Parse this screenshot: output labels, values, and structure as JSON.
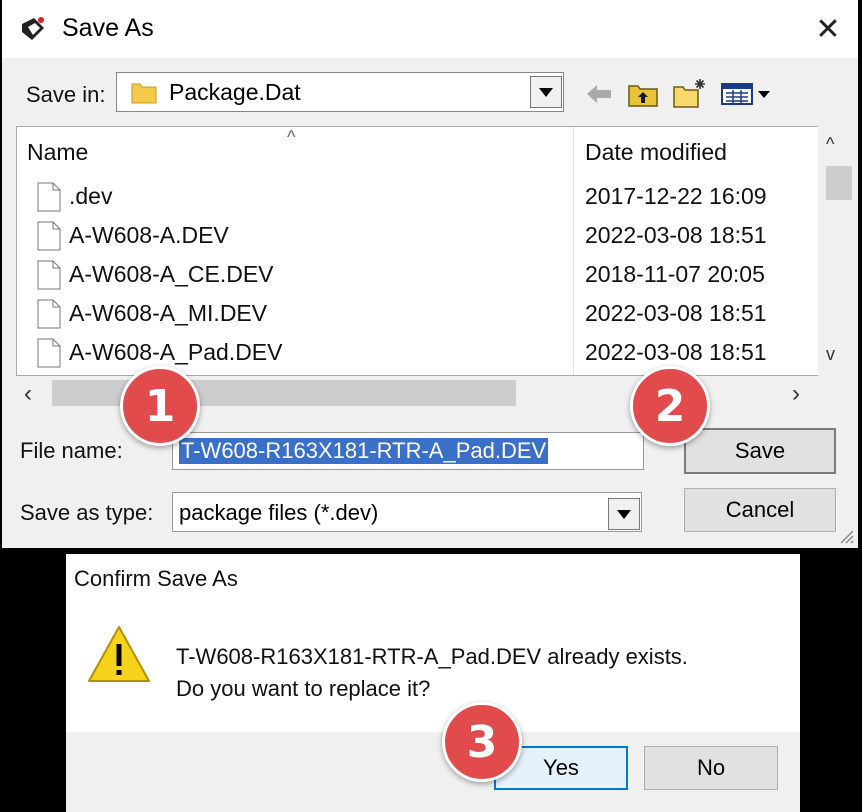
{
  "save_dialog": {
    "title": "Save As",
    "save_in_label": "Save in:",
    "save_in_value": "Package.Dat",
    "columns": {
      "name": "Name",
      "date": "Date modified"
    },
    "files": [
      {
        "name": ".dev",
        "date": "2017-12-22 16:09"
      },
      {
        "name": "A-W608-A.DEV",
        "date": "2022-03-08 18:51"
      },
      {
        "name": "A-W608-A_CE.DEV",
        "date": "2018-11-07 20:05"
      },
      {
        "name": "A-W608-A_MI.DEV",
        "date": "2022-03-08 18:51"
      },
      {
        "name": "A-W608-A_Pad.DEV",
        "date": "2022-03-08 18:51"
      }
    ],
    "file_name_label": "File name:",
    "file_name_value": "T-W608-R163X181-RTR-A_Pad.DEV",
    "save_as_type_label": "Save as type:",
    "save_as_type_value": "package files (*.dev)",
    "save_label": "Save",
    "cancel_label": "Cancel",
    "close_glyph": "✕"
  },
  "confirm_dialog": {
    "title": "Confirm Save As",
    "message_line1": "T-W608-R163X181-RTR-A_Pad.DEV already exists.",
    "message_line2": "Do you want to replace it?",
    "yes_label": "Yes",
    "no_label": "No"
  },
  "badges": [
    "1",
    "2",
    "3"
  ],
  "colors": {
    "badge": "#e24b4b",
    "selection": "#3a70c8",
    "warning": "#f7d21b",
    "default_button_border": "#0078d7"
  }
}
